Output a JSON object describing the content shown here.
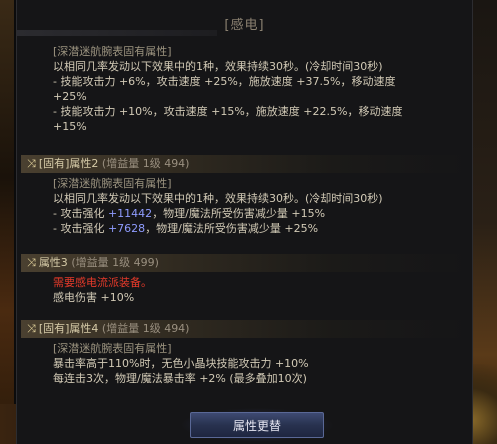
{
  "panel": {
    "title": "[感电]"
  },
  "top_section": {
    "lines": [
      "[深潜迷航腕表固有属性]",
      "以相同几率发动以下效果中的1种，效果持续30秒。(冷却时间30秒)",
      "- 技能攻击力 +6%，攻击速度 +25%，施放速度 +37.5%，移动速度",
      "+25%",
      "- 技能攻击力 +10%，攻击速度 +15%，施放速度 +22.5%，移动速度",
      "+15%"
    ]
  },
  "sections": [
    {
      "header": {
        "icon": "⤨",
        "label": "[固有]属性2",
        "extra": "(增益量 1级 494)"
      },
      "lines": [
        "[深潜迷航腕表固有属性]",
        "以相同几率发动以下效果中的1种，效果持续30秒。(冷却时间30秒)",
        {
          "pre": "- 攻击强化 ",
          "hl": "+11442",
          "post": "，物理/魔法所受伤害减少量 +15%"
        },
        {
          "pre": "- 攻击强化 ",
          "hl": "+7628",
          "post": "，物理/魔法所受伤害减少量 +25%"
        }
      ]
    },
    {
      "header": {
        "icon": "⤨",
        "label": "属性3",
        "extra": "(增益量 1级 499)"
      },
      "warning": "需要感电流派装备。",
      "lines": [
        "感电伤害 +10%"
      ]
    },
    {
      "header": {
        "icon": "⤨",
        "label": "[固有]属性4",
        "extra": "(增益量 1级 494)"
      },
      "lines": [
        "[深潜迷航腕表固有属性]",
        "暴击率高于110%时，无色小晶块技能攻击力 +10%",
        "每连击3次，物理/魔法暴击率 +2% (最多叠加10次)"
      ]
    }
  ],
  "button": {
    "label": "属性更替"
  },
  "colors": {
    "highlight_blue": "#8f9cff",
    "warning_red": "#e63a2a",
    "header_gold": "#d6cba8"
  }
}
